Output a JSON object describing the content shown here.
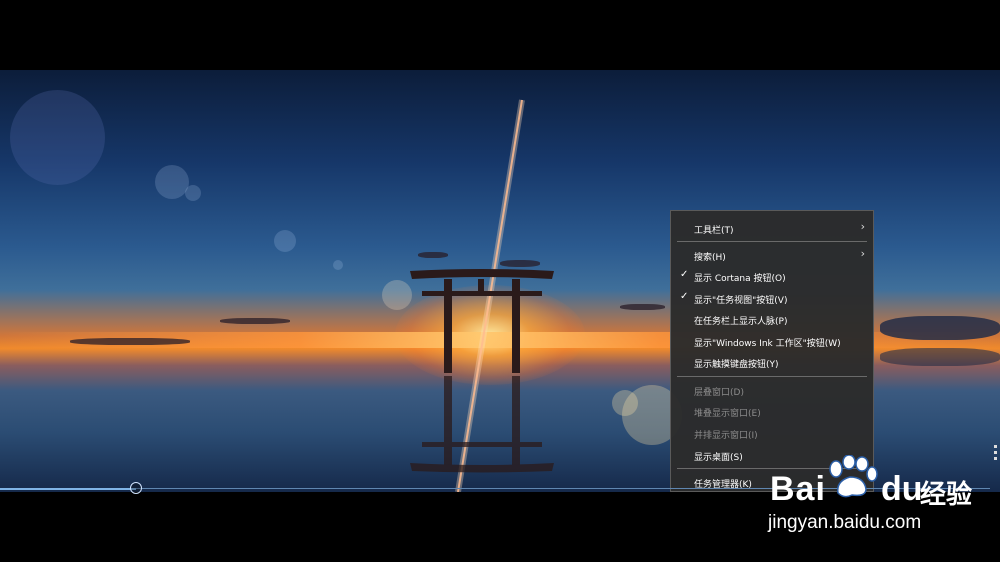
{
  "context_menu": {
    "items": [
      {
        "label": "工具栏(T)",
        "checked": false,
        "disabled": false,
        "submenu": true
      },
      {
        "label": "搜索(H)",
        "checked": false,
        "disabled": false,
        "submenu": true
      },
      {
        "label": "显示 Cortana 按钮(O)",
        "checked": true,
        "disabled": false,
        "submenu": false
      },
      {
        "label": "显示\"任务视图\"按钮(V)",
        "checked": true,
        "disabled": false,
        "submenu": false
      },
      {
        "label": "在任务栏上显示人脉(P)",
        "checked": false,
        "disabled": false,
        "submenu": false
      },
      {
        "label": "显示\"Windows Ink 工作区\"按钮(W)",
        "checked": false,
        "disabled": false,
        "submenu": false
      },
      {
        "label": "显示触摸键盘按钮(Y)",
        "checked": false,
        "disabled": false,
        "submenu": false
      },
      {
        "label": "层叠窗口(D)",
        "checked": false,
        "disabled": true,
        "submenu": false
      },
      {
        "label": "堆叠显示窗口(E)",
        "checked": false,
        "disabled": true,
        "submenu": false
      },
      {
        "label": "并排显示窗口(I)",
        "checked": false,
        "disabled": true,
        "submenu": false
      },
      {
        "label": "显示桌面(S)",
        "checked": false,
        "disabled": false,
        "submenu": false
      },
      {
        "label": "任务管理器(K)",
        "checked": false,
        "disabled": false,
        "submenu": false
      }
    ],
    "check_glyph": "✓",
    "arrow_glyph": "›"
  },
  "video_progress": {
    "fraction": 0.137
  },
  "watermark": {
    "brand_part1": "Bai",
    "brand_part2": "du",
    "product": "经验",
    "url": "jingyan.baidu.com"
  },
  "icons": {
    "check": "check-icon",
    "submenu": "chevron-right-icon",
    "logo": "baidu-paw-logo"
  },
  "colors": {
    "menu_bg": "#2b2b2b",
    "menu_text": "#ffffff",
    "menu_disabled_text": "#8c8c8c",
    "progress": "#7fb4e6"
  }
}
